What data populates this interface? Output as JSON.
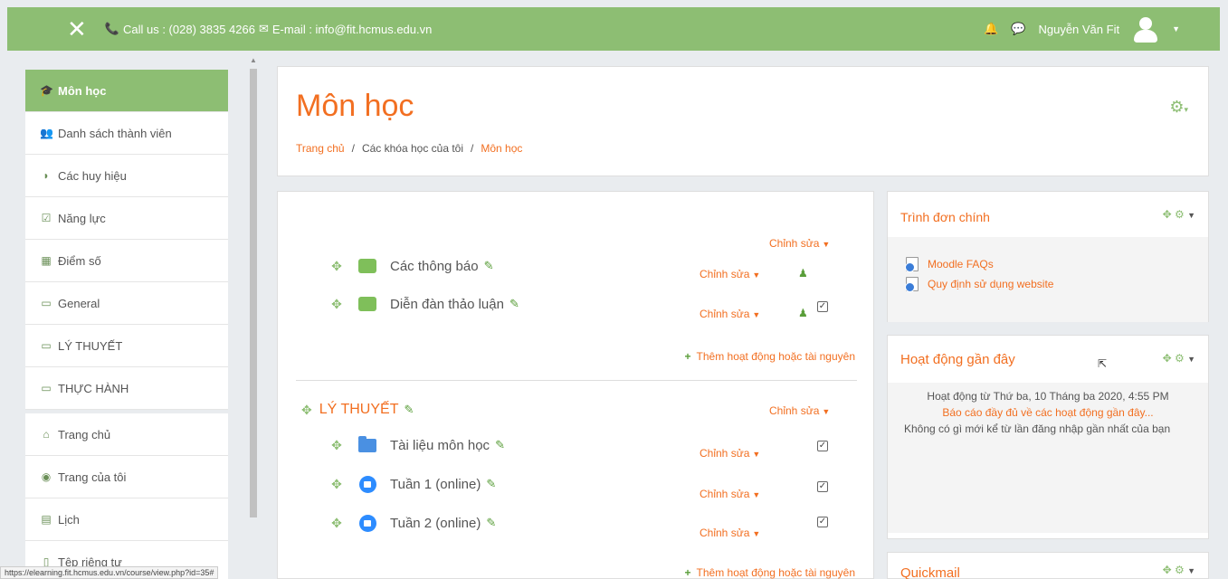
{
  "topbar": {
    "contact": "Call us : (028) 3835 4266",
    "email": "E-mail : info@fit.hcmus.edu.vn",
    "username": "Nguyễn Văn Fit"
  },
  "sidebar": {
    "items": [
      {
        "label": "Môn học",
        "icon": "graduation-cap-icon",
        "glyph": "🎓"
      },
      {
        "label": "Danh sách thành viên",
        "icon": "users-icon",
        "glyph": "👥"
      },
      {
        "label": "Các huy hiệu",
        "icon": "shield-icon",
        "glyph": "◗"
      },
      {
        "label": "Năng lực",
        "icon": "check-square-icon",
        "glyph": "☑"
      },
      {
        "label": "Điểm số",
        "icon": "table-icon",
        "glyph": "▦"
      },
      {
        "label": "General",
        "icon": "folder-icon",
        "glyph": "▭"
      },
      {
        "label": "LÝ THUYẾT",
        "icon": "folder-icon",
        "glyph": "▭"
      },
      {
        "label": "THỰC HÀNH",
        "icon": "folder-icon",
        "glyph": "▭"
      },
      {
        "label": "Trang chủ",
        "icon": "home-icon",
        "glyph": "⌂"
      },
      {
        "label": "Trang của tôi",
        "icon": "dashboard-icon",
        "glyph": "◉"
      },
      {
        "label": "Lịch",
        "icon": "calendar-icon",
        "glyph": "▤"
      },
      {
        "label": "Tệp riêng tư",
        "icon": "file-icon",
        "glyph": "▯"
      }
    ]
  },
  "status_url": "https://elearning.fit.hcmus.edu.vn/course/view.php?id=35#",
  "header": {
    "title": "Môn học",
    "breadcrumb": [
      "Trang chủ",
      "Các khóa học của tôi",
      "Môn học"
    ]
  },
  "main": {
    "edit_label": "Chỉnh sửa",
    "add_activity": "Thêm hoạt động hoặc tài nguyên",
    "activities_top": [
      {
        "label": "Các thông báo"
      },
      {
        "label": "Diễn đàn thảo luận"
      }
    ],
    "section_title": "LÝ THUYẾT",
    "activities_section": [
      {
        "label": "Tài liệu môn học"
      },
      {
        "label": "Tuần 1 (online)"
      },
      {
        "label": "Tuần 2 (online)"
      }
    ]
  },
  "blocks": {
    "main_menu": {
      "title": "Trình đơn chính",
      "links": [
        "Moodle FAQs",
        "Quy định sử dụng website"
      ]
    },
    "recent": {
      "title": "Hoạt động gần đây",
      "since": "Hoạt động từ Thứ ba, 10 Tháng ba 2020, 4:55 PM",
      "full_report": "Báo cáo đầy đủ về các hoạt động gần đây...",
      "nothing": "Không có gì mới kể từ lần đăng nhập gần nhất của bạn"
    },
    "quickmail": {
      "title": "Quickmail"
    }
  }
}
